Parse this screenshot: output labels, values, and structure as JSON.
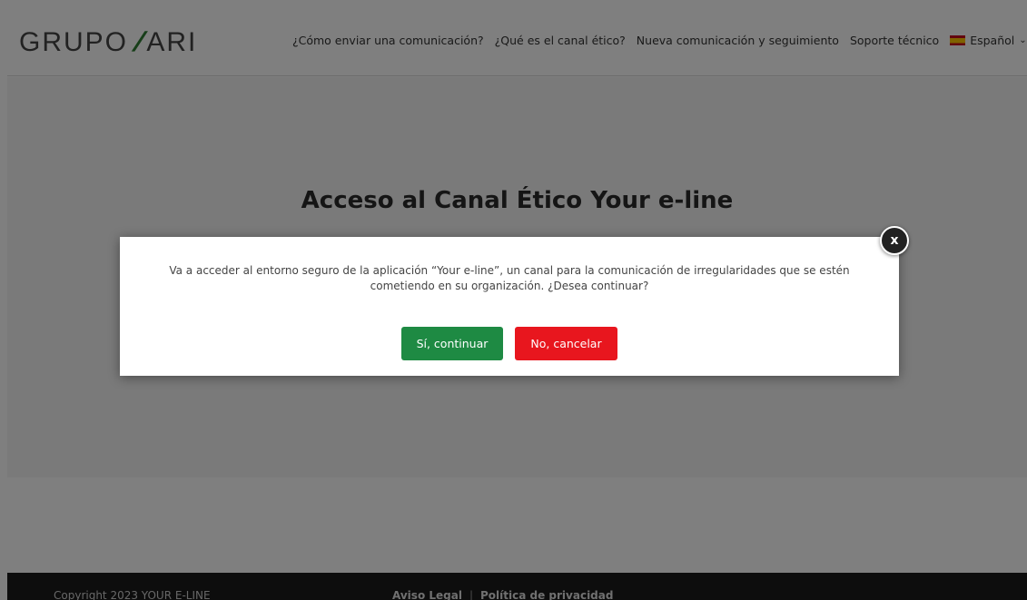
{
  "header": {
    "logo_text_left": "GRUPO",
    "logo_text_right": "ARI",
    "nav": [
      {
        "label": "¿Cómo enviar una comunicación?"
      },
      {
        "label": "¿Qué es el canal ético?"
      },
      {
        "label": "Nueva comunicación y seguimiento"
      },
      {
        "label": "Soporte técnico"
      }
    ],
    "language": "Español"
  },
  "hero": {
    "title": "Acceso al Canal Ético Your e-line"
  },
  "modal": {
    "message": "Va a acceder al entorno seguro de la aplicación “Your e-line”, un canal para la comunicación de irregularidades que se estén cometiendo en su organización. ¿Desea continuar?",
    "confirm_label": "Sí, continuar",
    "cancel_label": "No, cancelar",
    "close_glyph": "x"
  },
  "footer": {
    "copyright": "Copyright 2023 YOUR E-LINE",
    "links": [
      {
        "label": "Aviso Legal"
      },
      {
        "label": "Política de privacidad"
      }
    ],
    "separator": "|"
  },
  "colors": {
    "confirm": "#1e8a43",
    "cancel": "#e8161e",
    "logo_accent": "#2e7d32"
  }
}
